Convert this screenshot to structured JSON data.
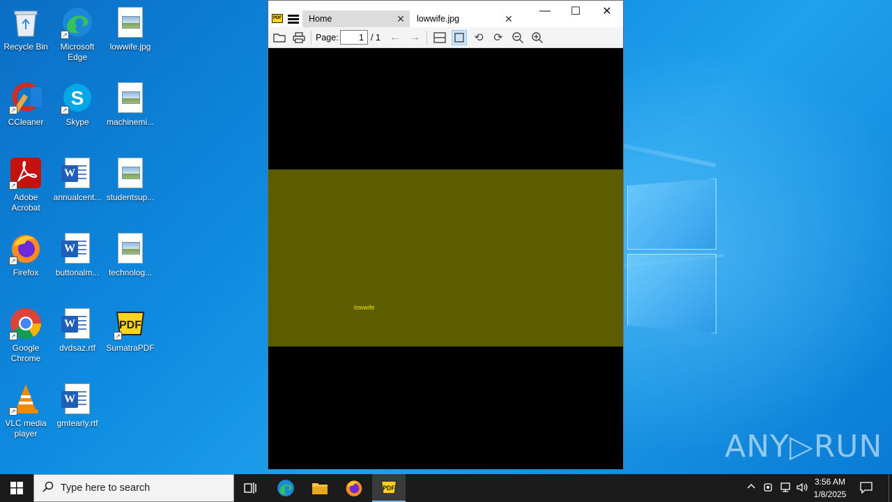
{
  "desktop": {
    "icons": [
      {
        "label": "Recycle Bin",
        "icon": "recycle-bin-icon"
      },
      {
        "label": "Microsoft Edge",
        "icon": "edge-icon"
      },
      {
        "label": "lowwife.jpg",
        "icon": "image-file-icon"
      },
      {
        "label": "CCleaner",
        "icon": "ccleaner-icon"
      },
      {
        "label": "Skype",
        "icon": "skype-icon"
      },
      {
        "label": "machinemi...",
        "icon": "image-file-icon"
      },
      {
        "label": "Adobe Acrobat",
        "icon": "acrobat-icon"
      },
      {
        "label": "annualcent...",
        "icon": "word-doc-icon"
      },
      {
        "label": "studentsup...",
        "icon": "image-file-icon"
      },
      {
        "label": "Firefox",
        "icon": "firefox-icon"
      },
      {
        "label": "buttonalm...",
        "icon": "word-doc-icon"
      },
      {
        "label": "technolog...",
        "icon": "image-file-icon"
      },
      {
        "label": "Google Chrome",
        "icon": "chrome-icon"
      },
      {
        "label": "dvdsaz.rtf",
        "icon": "word-doc-icon"
      },
      {
        "label": "SumatraPDF",
        "icon": "sumatra-icon"
      },
      {
        "label": "VLC media player",
        "icon": "vlc-icon"
      },
      {
        "label": "gmtearly.rtf",
        "icon": "word-doc-icon"
      }
    ]
  },
  "viewer": {
    "tabs": [
      {
        "label": "Home"
      },
      {
        "label": "lowwife.jpg"
      }
    ],
    "toolbar": {
      "page_label": "Page:",
      "page_value": "1",
      "page_total": "/ 1"
    },
    "image_text": "lowwife",
    "colors": {
      "image_fill": "#5c5c00",
      "image_text": "#e6e600",
      "canvas": "#000000"
    }
  },
  "watermark": "ANY▷RUN",
  "taskbar": {
    "search_placeholder": "Type here to search",
    "time": "3:56 AM",
    "date": "1/8/2025"
  }
}
